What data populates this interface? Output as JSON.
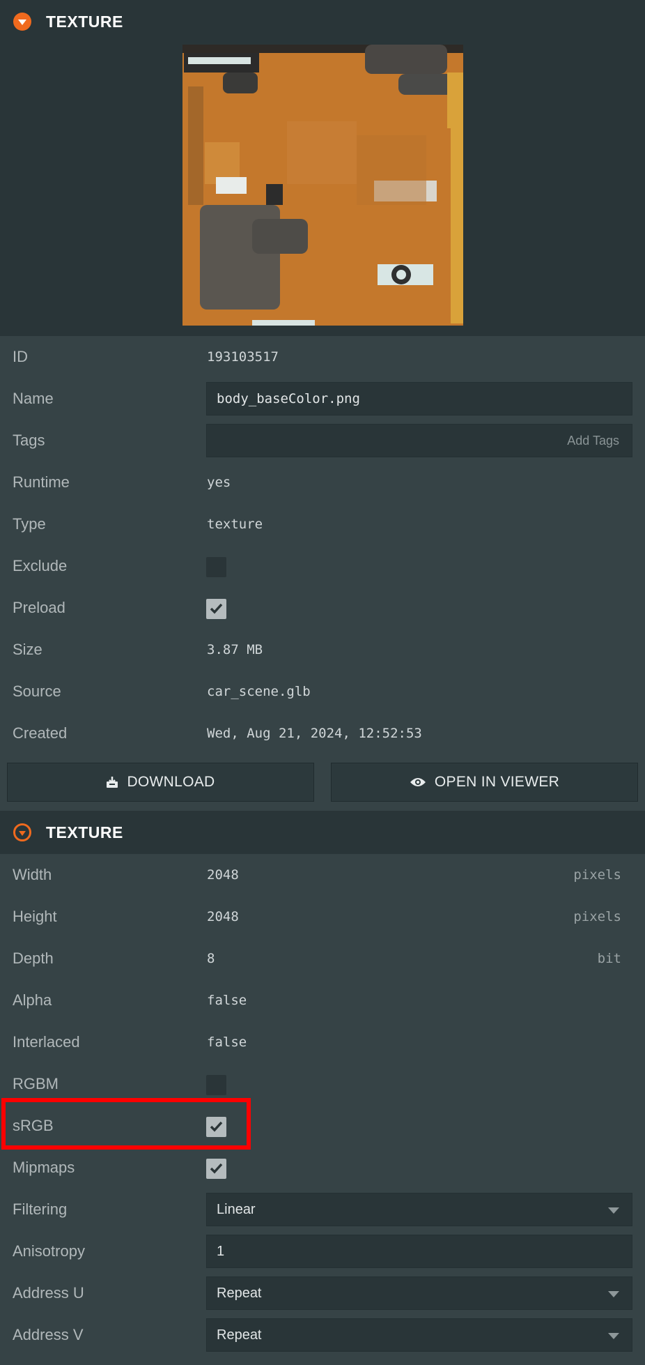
{
  "header1": {
    "title": "TEXTURE"
  },
  "asset": {
    "rows": [
      {
        "label": "ID",
        "value": "193103517"
      },
      {
        "label": "Name",
        "value": "body_baseColor.png"
      },
      {
        "label": "Tags",
        "placeholder": "Add Tags"
      },
      {
        "label": "Runtime",
        "value": "yes"
      },
      {
        "label": "Type",
        "value": "texture"
      },
      {
        "label": "Exclude",
        "checked": false
      },
      {
        "label": "Preload",
        "checked": true
      },
      {
        "label": "Size",
        "value": "3.87 MB"
      },
      {
        "label": "Source",
        "value": "car_scene.glb"
      },
      {
        "label": "Created",
        "value": "Wed, Aug 21, 2024, 12:52:53"
      }
    ],
    "download_label": "DOWNLOAD",
    "viewer_label": "OPEN IN VIEWER"
  },
  "header2": {
    "title": "TEXTURE"
  },
  "texture": {
    "rows": [
      {
        "label": "Width",
        "value": "2048",
        "unit": "pixels"
      },
      {
        "label": "Height",
        "value": "2048",
        "unit": "pixels"
      },
      {
        "label": "Depth",
        "value": "8",
        "unit": "bit"
      },
      {
        "label": "Alpha",
        "value": "false"
      },
      {
        "label": "Interlaced",
        "value": "false"
      },
      {
        "label": "RGBM",
        "checked": false
      },
      {
        "label": "sRGB",
        "checked": true
      },
      {
        "label": "Mipmaps",
        "checked": true
      },
      {
        "label": "Filtering",
        "value": "Linear"
      },
      {
        "label": "Anisotropy",
        "value": "1"
      },
      {
        "label": "Address U",
        "value": "Repeat"
      },
      {
        "label": "Address V",
        "value": "Repeat"
      }
    ]
  },
  "colors": {
    "accent": "#f06a1e",
    "highlight": "#ff0000"
  }
}
